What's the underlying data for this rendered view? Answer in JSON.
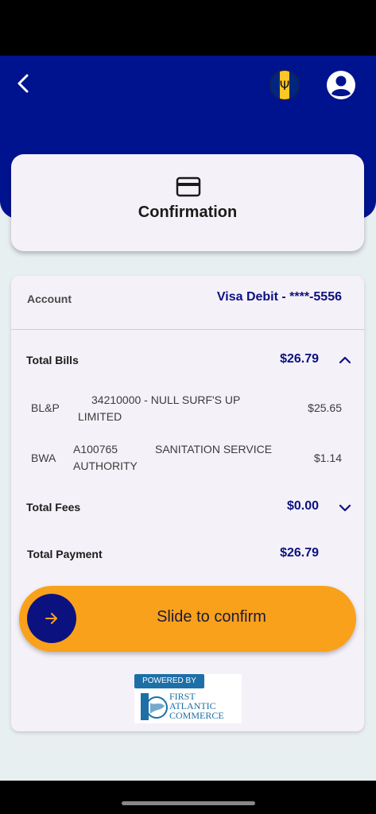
{
  "header": {
    "back_icon": "chevron-left-icon",
    "flag_icon": "barbados-flag-icon",
    "profile_icon": "user-circle-icon",
    "flag_symbol": "Ψ"
  },
  "title_card": {
    "icon": "credit-card-icon",
    "title": "Confirmation"
  },
  "account": {
    "label": "Account",
    "value": "Visa Debit - ****-5556"
  },
  "total_bills": {
    "label": "Total Bills",
    "value": "$26.79",
    "expanded": true
  },
  "bills": [
    {
      "code": "BL&P",
      "description": "34210000 - NULL SURF'S UP LIMITED",
      "desc_line1": "34210000 - NULL SURF'S UP",
      "desc_line2": "LIMITED",
      "amount": "$25.65"
    },
    {
      "code": "BWA",
      "description": "A100765 SANITATION SERVICE AUTHORITY",
      "desc_line1a": "A100765",
      "desc_line1b": "SANITATION SERVICE",
      "desc_line2": "AUTHORITY",
      "amount": "$1.14"
    }
  ],
  "total_fees": {
    "label": "Total Fees",
    "value": "$0.00",
    "expanded": false
  },
  "total_payment": {
    "label": "Total Payment",
    "value": "$26.79"
  },
  "slider": {
    "label": "Slide to confirm",
    "icon": "arrow-right-icon"
  },
  "powered_by": {
    "badge": "POWERED BY",
    "line1": "FIRST",
    "line2": "ATLANTIC",
    "line3": "COMMERCE"
  },
  "colors": {
    "header_blue": "#00138f",
    "accent_navy": "#0b1280",
    "slider_orange": "#f9a11b",
    "card_bg": "#f5f1f8"
  }
}
